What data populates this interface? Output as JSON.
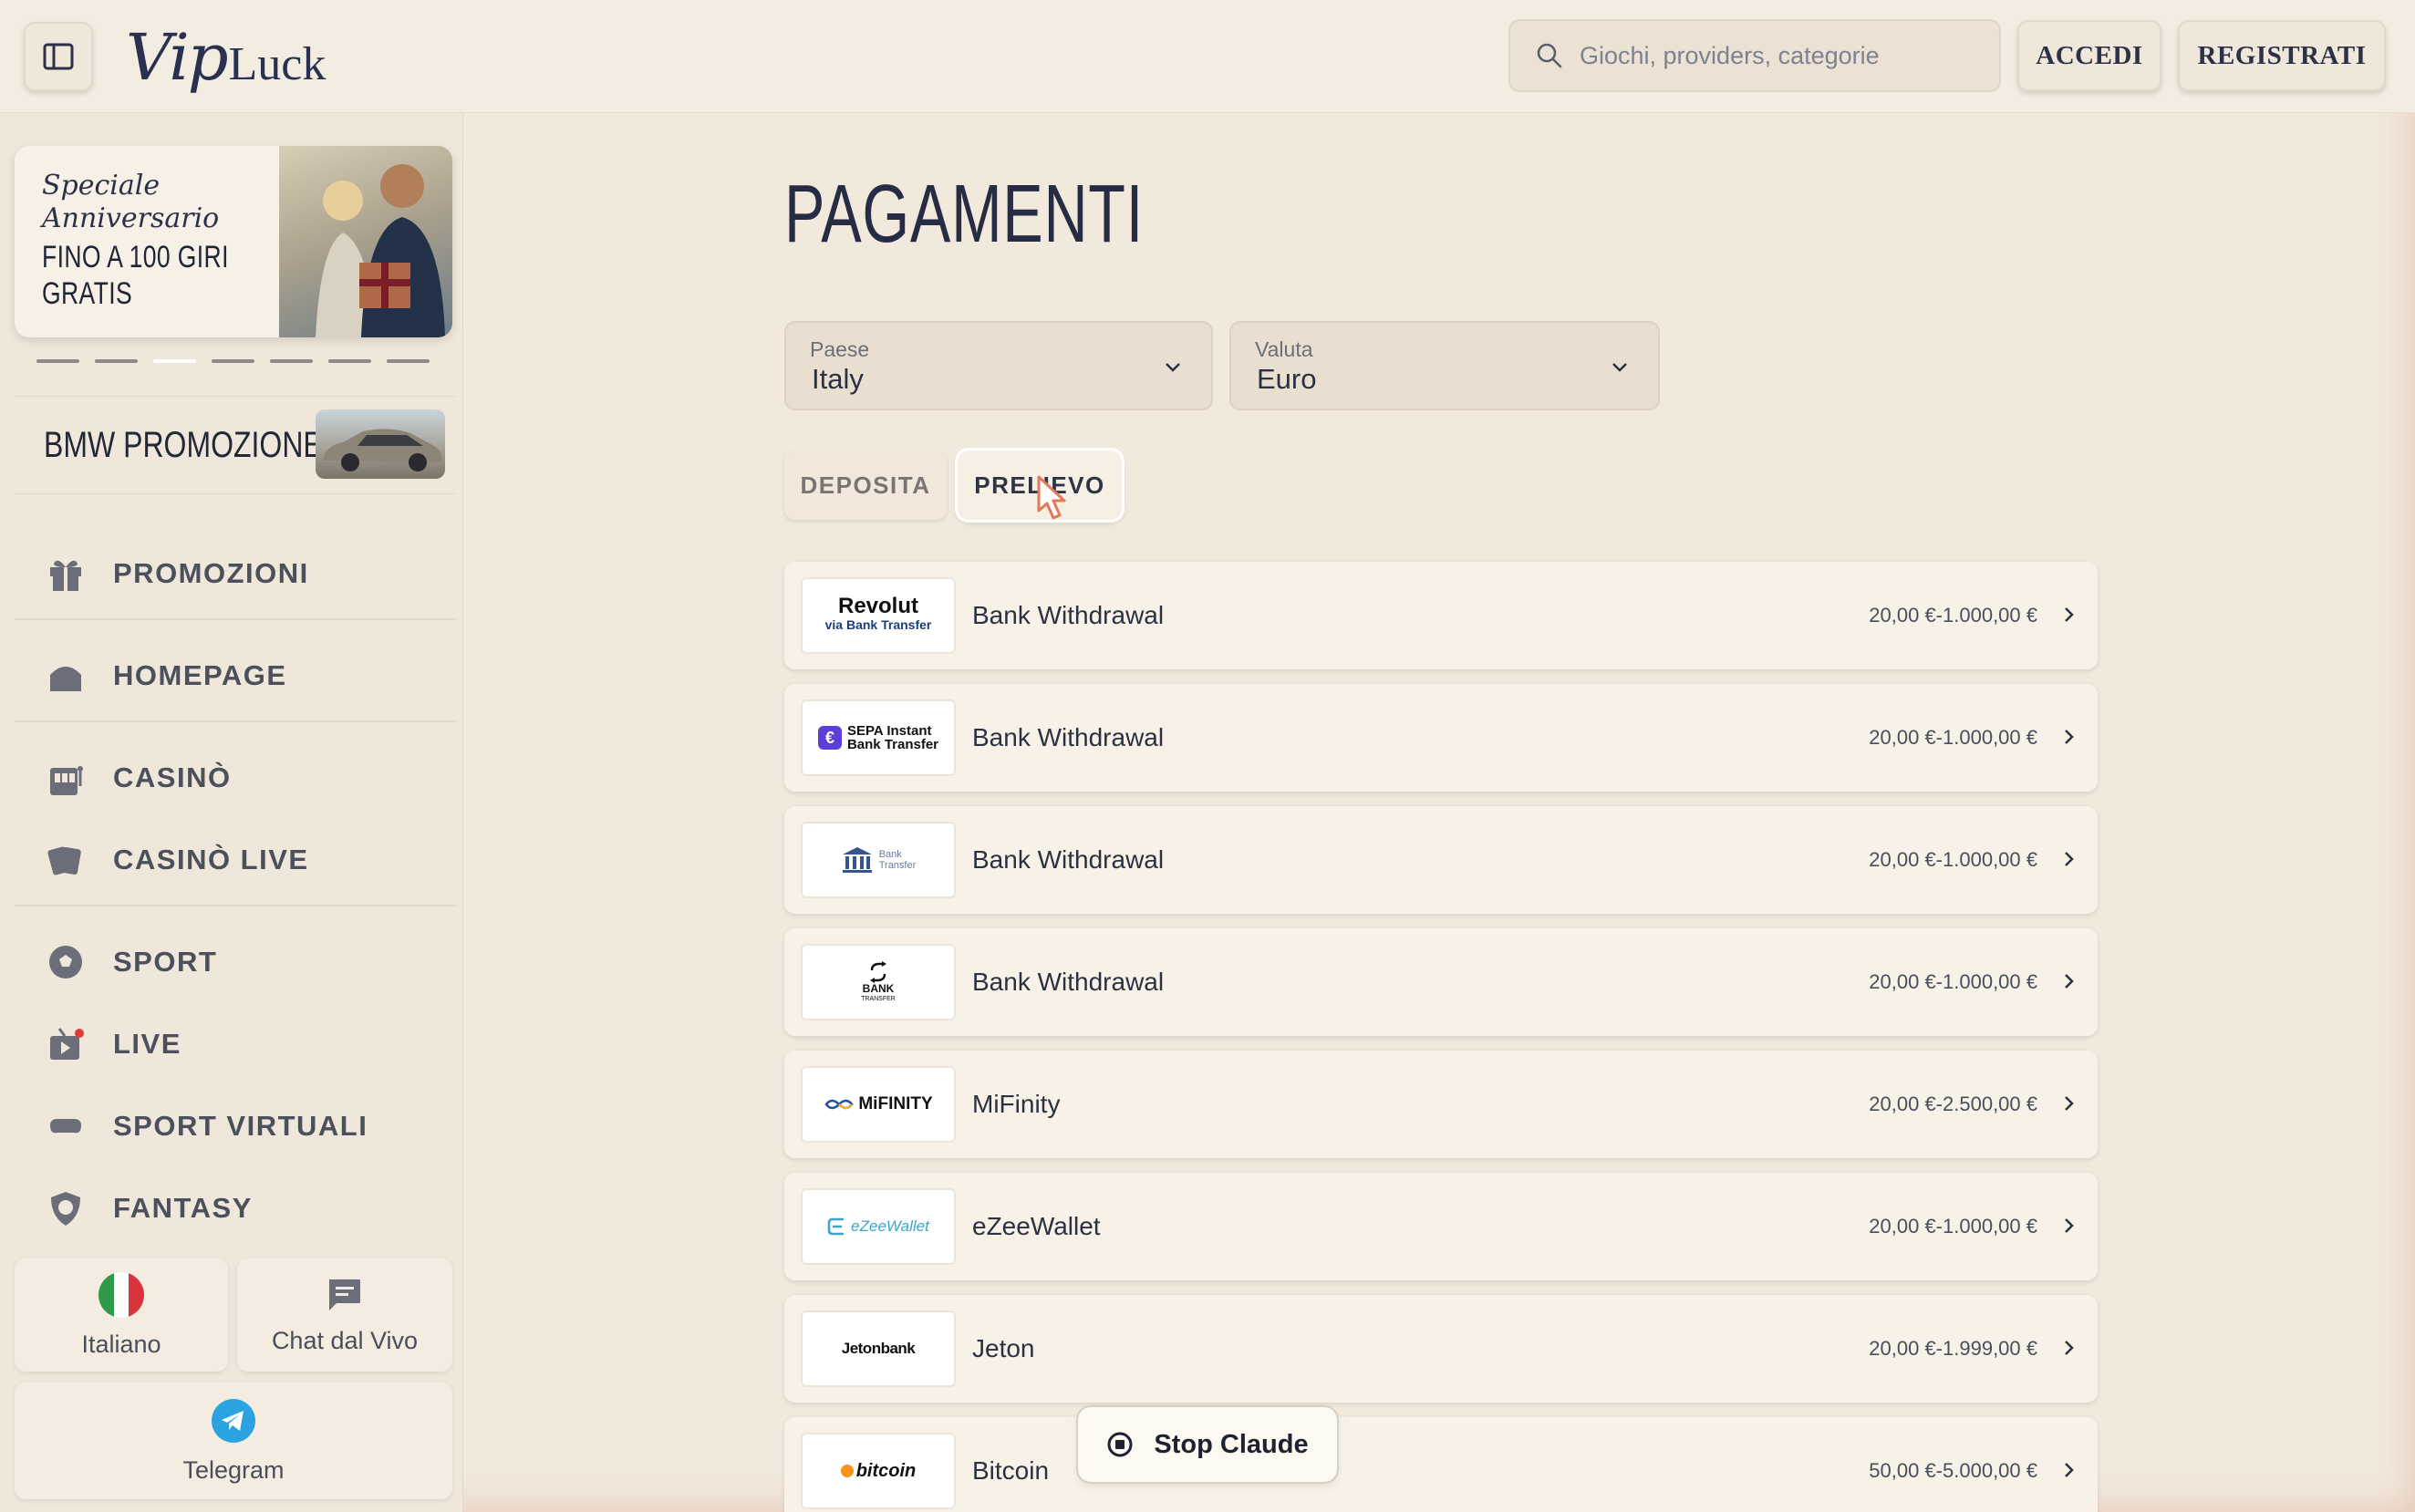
{
  "header": {
    "logo_script": "Vip",
    "logo_text": "Luck",
    "search_placeholder": "Giochi, providers, categorie",
    "login_label": "ACCEDI",
    "register_label": "REGISTRATI"
  },
  "sidebar": {
    "promo": {
      "script_text": "Speciale Anniversario",
      "headline": "FINO A 100 GIRI GRATIS",
      "slide_count": 7,
      "active_slide": 3
    },
    "bmw_label": "BMW PROMOZIONE",
    "items": [
      {
        "label": "PROMOZIONI",
        "icon": "gift-icon"
      },
      {
        "label": "HOMEPAGE",
        "icon": "home-icon"
      },
      {
        "label": "CASINÒ",
        "icon": "casino-icon"
      },
      {
        "label": "CASINÒ LIVE",
        "icon": "cards-icon"
      },
      {
        "label": "SPORT",
        "icon": "soccer-ball-icon"
      },
      {
        "label": "LIVE",
        "icon": "tv-live-icon"
      },
      {
        "label": "SPORT VIRTUALI",
        "icon": "gamepad-icon"
      },
      {
        "label": "FANTASY",
        "icon": "shield-icon"
      }
    ],
    "language_label": "Italiano",
    "chat_label": "Chat dal Vivo",
    "telegram_label": "Telegram"
  },
  "main": {
    "title": "PAGAMENTI",
    "country": {
      "label": "Paese",
      "value": "Italy"
    },
    "currency": {
      "label": "Valuta",
      "value": "Euro"
    },
    "tabs": {
      "deposit": "DEPOSITA",
      "withdraw": "PRELIEVO",
      "active": "withdraw"
    },
    "methods": [
      {
        "logo": "Revolut",
        "logo_sub": "via Bank Transfer",
        "name": "Bank Withdrawal",
        "range": "20,00 €-1.000,00 €"
      },
      {
        "logo": "SEPA Instant",
        "logo_sub": "Bank Transfer",
        "name": "Bank Withdrawal",
        "range": "20,00 €-1.000,00 €"
      },
      {
        "logo": "Bank",
        "logo_sub": "Transfer",
        "name": "Bank Withdrawal",
        "range": "20,00 €-1.000,00 €"
      },
      {
        "logo": "BANK",
        "logo_sub": "TRANSFER",
        "name": "Bank Withdrawal",
        "range": "20,00 €-1.000,00 €"
      },
      {
        "logo": "MiFINITY",
        "logo_sub": "",
        "name": "MiFinity",
        "range": "20,00 €-2.500,00 €"
      },
      {
        "logo": "eZeeWallet",
        "logo_sub": "",
        "name": "eZeeWallet",
        "range": "20,00 €-1.000,00 €"
      },
      {
        "logo": "Jetonbank",
        "logo_sub": "",
        "name": "Jeton",
        "range": "20,00 €-1.999,00 €"
      },
      {
        "logo": "bitcoin",
        "logo_sub": "",
        "name": "Bitcoin",
        "range": "50,00 €-5.000,00 €"
      }
    ]
  },
  "overlay": {
    "stop_label": "Stop Claude"
  },
  "colors": {
    "background": "#f1e9dc",
    "text": "#2c3142",
    "accent_sepa": "#5b3fd6",
    "mifinity_blue": "#1d4fa8",
    "ezee": "#3da5c9",
    "bitcoin": "#f7931a",
    "telegram": "#2aa3e0",
    "live_dot": "#e23a3a"
  }
}
